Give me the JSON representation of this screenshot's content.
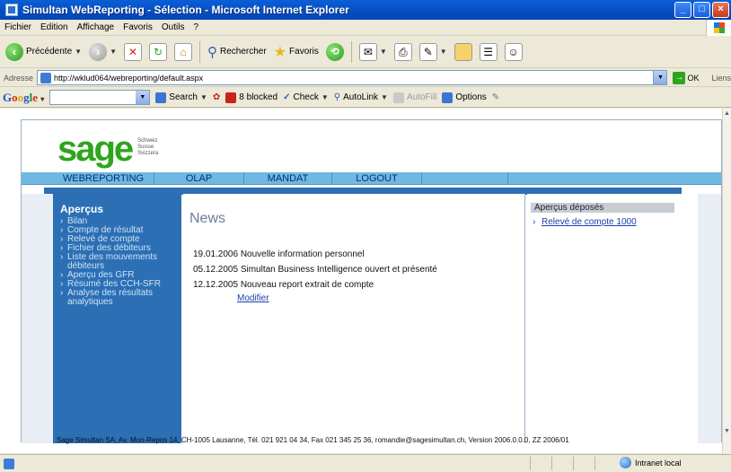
{
  "window": {
    "title": "Simultan WebReporting - Sélection - Microsoft Internet Explorer"
  },
  "menu": [
    "Fichier",
    "Edition",
    "Affichage",
    "Favoris",
    "Outils",
    "?"
  ],
  "toolbar": {
    "back_label": "Précédente",
    "search_label": "Rechercher",
    "favorites_label": "Favoris"
  },
  "address": {
    "label": "Adresse",
    "url": "http://wklud064/webreporting/default.aspx",
    "go_label": "OK",
    "links_label": "Liens"
  },
  "google": {
    "logo": "Google",
    "search_label": "Search",
    "blocked_label": "8 blocked",
    "check_label": "Check",
    "autolink_label": "AutoLink",
    "autofill_label": "AutoFill",
    "options_label": "Options"
  },
  "site": {
    "logo": "sage",
    "logo_sub": [
      "Schweiz",
      "Suisse",
      "Svizzera"
    ],
    "nav": [
      "WEBREPORTING",
      "OLAP",
      "MANDAT",
      "LOGOUT"
    ],
    "sidebar": {
      "heading": "Aperçus",
      "items": [
        "Bilan",
        "Compte de résultat",
        "Relevé de compte",
        "Fichier des débiteurs",
        "Liste des mouvements débiteurs",
        "Aperçu des GFR",
        "Résumé des CCH-SFR",
        "Analyse des résultats analytiques"
      ]
    },
    "news": {
      "title": "News",
      "items": [
        "19.01.2006 Nouvelle information personnel",
        "05.12.2005 Simultan Business Intelligence ouvert et présenté",
        "12.12.2005 Nouveau report extrait de compte"
      ],
      "modify_label": "Modifier"
    },
    "right": {
      "heading": "Aperçus déposés",
      "links": [
        "Relevé de compte 1000"
      ]
    },
    "footer": "Sage Simultan SA, Av. Mon-Repos 14, CH-1005 Lausanne, Tél. 021 921 04 34, Fax 021 345 25 36, romandie@sagesimultan.ch, Version 2006.0.0.0, ZZ 2006/01"
  },
  "status": {
    "zone": "Intranet local"
  },
  "colors": {
    "sage_green": "#2DA51D",
    "sidebar_blue": "#2C6FB5",
    "nav_blue": "#6FB8E3",
    "link_blue": "#1A3FAA"
  }
}
